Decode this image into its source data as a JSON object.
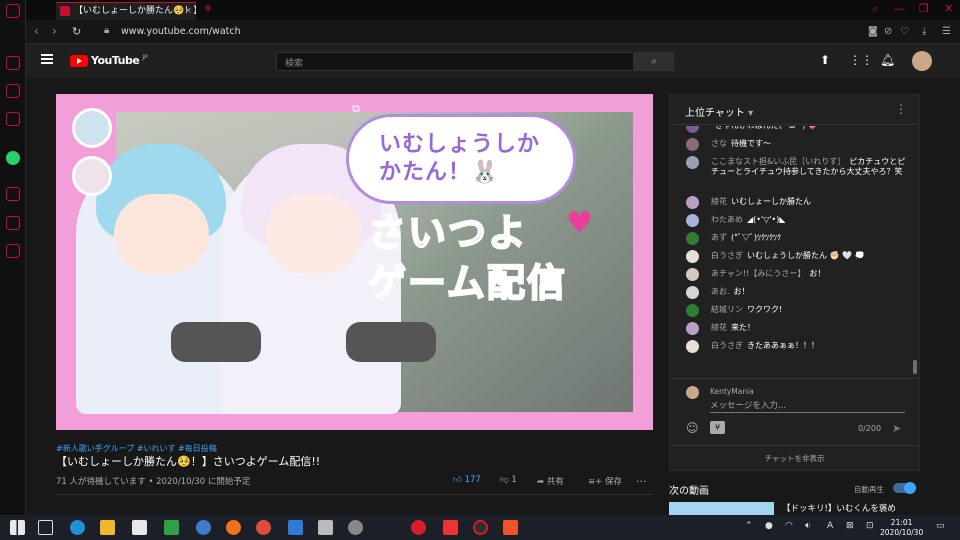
{
  "browser": {
    "tab_title": "【いむしょーしか勝たん🥺！】さ",
    "tab_close": "×",
    "new_tab": "+",
    "url": "www.youtube.com/watch"
  },
  "youtube": {
    "logo_text": "YouTube",
    "logo_region": "JP",
    "search_placeholder": "検索"
  },
  "video": {
    "thumb_line1": "いむしょうしか",
    "thumb_line2": "かたん！🐰",
    "thumb_big1": "さいつよ",
    "thumb_big2": "ゲーム配信",
    "tags": "#新人歌い手グループ #いれいす #毎日投稿",
    "title": "【いむしょーしか勝たん🥺！】さいつよゲーム配信!!",
    "waiting": "71 人が待機しています • 2020/10/30 に開始予定",
    "likes": "177",
    "dislikes": "1",
    "share": "共有",
    "save": "保存",
    "more": "..."
  },
  "chat": {
    "header": "上位チャット",
    "messages": [
      {
        "name": "",
        "text": "きゃんかわぼんだ(^ω^) 💖",
        "color": "#7a5c9a"
      },
      {
        "name": "さな",
        "text": "待機です〜",
        "color": "#8b6a7a"
      },
      {
        "name": "ここまなスト担&いふ民［いれりす］",
        "text": "ピカチュウとピチューとライチュウ持参してきたから大丈夫やろ？笑",
        "color": "#9aa0b3"
      },
      {
        "name": "綾花",
        "text": "いむしょーしか勝たん",
        "color": "#b8a0c8"
      },
      {
        "name": "わたあめ",
        "text": "◢(•'▽'•)◣",
        "color": "#a4b5d9"
      },
      {
        "name": "あず",
        "text": "(*ﾟ▽ﾟ)ﾂｸﾂｸﾂｸ",
        "color": "#2e7d32"
      },
      {
        "name": "白うさぎ",
        "text": "いむしょうしか勝たん ✊🏻 🤍 💭",
        "color": "#e8e0d6"
      },
      {
        "name": "あチャン!!【みにうさー】",
        "text": "お！",
        "color": "#d7c9c0"
      },
      {
        "name": "あお.",
        "text": "お！",
        "color": "#d6d3dc"
      },
      {
        "name": "結城リン",
        "text": "ワクワク!",
        "color": "#2e7d32"
      },
      {
        "name": "綾花",
        "text": "来た！",
        "color": "#b8a0c8"
      },
      {
        "name": "白うさぎ",
        "text": "きたああぁぁ！！！",
        "color": "#e8e0d6"
      }
    ],
    "user_name": "KentyMania",
    "input_placeholder": "メッセージを入力...",
    "counter": "0/200",
    "hide_chat": "チャットを非表示"
  },
  "next": {
    "label": "次の動画",
    "autoplay": "自動再生",
    "first_title": "【ドッキリ!】いむくんを褒め"
  },
  "taskbar": {
    "time": "21:01",
    "date": "2020/10/30"
  }
}
